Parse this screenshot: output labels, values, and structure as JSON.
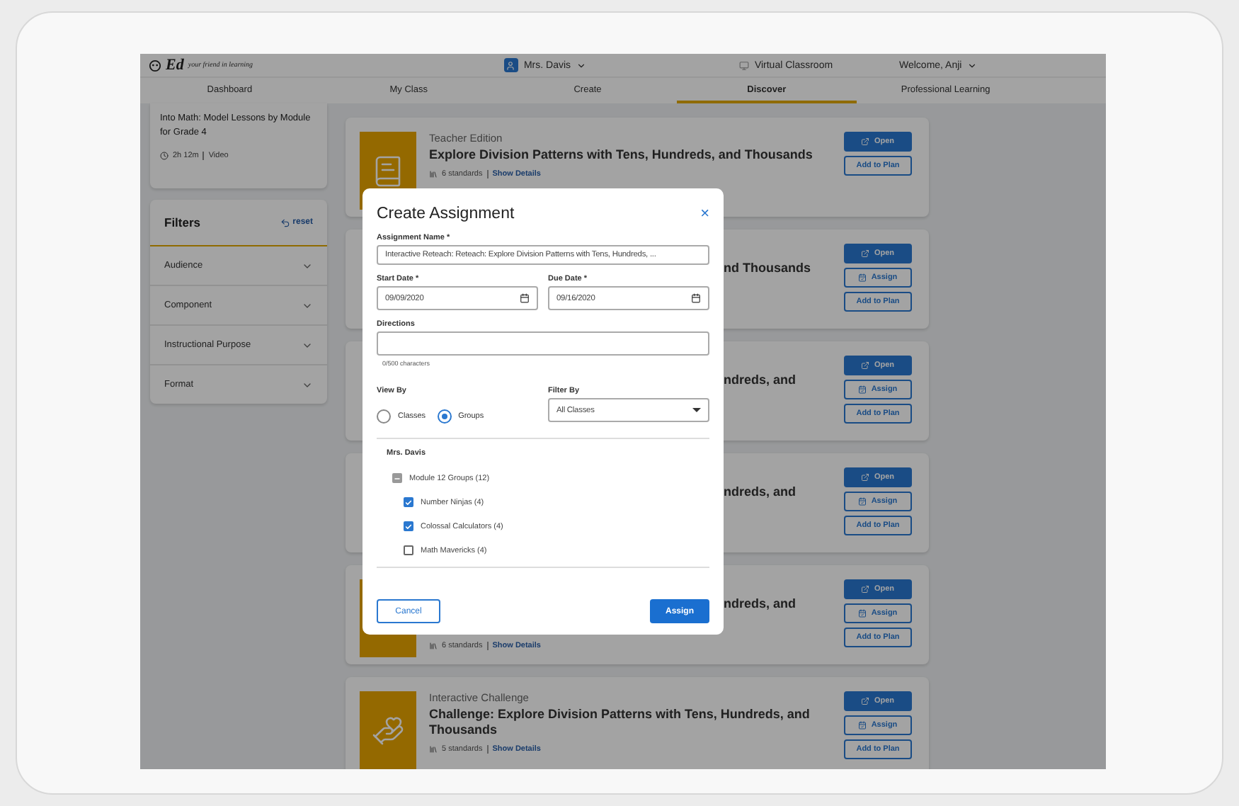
{
  "header": {
    "logo": {
      "text": "Ed",
      "tagline": "your friend in learning"
    },
    "teacher": "Mrs. Davis",
    "virtual": "Virtual Classroom",
    "welcome": "Welcome, Anji"
  },
  "nav": [
    {
      "label": "Dashboard",
      "selected": false
    },
    {
      "label": "My Class",
      "selected": false
    },
    {
      "label": "Create",
      "selected": false
    },
    {
      "label": "Discover",
      "selected": true
    },
    {
      "label": "Professional Learning",
      "selected": false
    }
  ],
  "sidebar": {
    "lesson": {
      "title": "Into Math: Model Lessons by Module for Grade 4",
      "duration": "2h 12m",
      "format": "Video"
    },
    "filters": {
      "title": "Filters",
      "reset": "reset",
      "items": [
        "Audience",
        "Component",
        "Instructional Purpose",
        "Format"
      ]
    }
  },
  "cards": [
    {
      "covered": false,
      "kind": "book",
      "type": "Teacher Edition",
      "title": "Explore Division Patterns with Tens, Hundreds, and Thousands",
      "standards": "6 standards",
      "details": "Show Details",
      "buttons": [
        {
          "kind": "open",
          "label": "Open"
        },
        {
          "kind": "plan",
          "label": "Add to Plan"
        }
      ]
    },
    {
      "covered": true,
      "title": "nd Thousands",
      "buttons": [
        {
          "kind": "open",
          "label": "Open"
        },
        {
          "kind": "assign",
          "label": "Assign"
        },
        {
          "kind": "plan",
          "label": "Add to Plan"
        }
      ]
    },
    {
      "covered": true,
      "title": "ndreds, and",
      "buttons": [
        {
          "kind": "open",
          "label": "Open"
        },
        {
          "kind": "assign",
          "label": "Assign"
        },
        {
          "kind": "plan",
          "label": "Add to Plan"
        }
      ]
    },
    {
      "covered": true,
      "title": "ndreds, and",
      "buttons": [
        {
          "kind": "open",
          "label": "Open"
        },
        {
          "kind": "assign",
          "label": "Assign"
        },
        {
          "kind": "plan",
          "label": "Add to Plan"
        }
      ]
    },
    {
      "covered": true,
      "kind": "blank",
      "title": "ndreds, and",
      "standards": "6 standards",
      "details": "Show Details",
      "buttons": [
        {
          "kind": "open",
          "label": "Open"
        },
        {
          "kind": "assign",
          "label": "Assign"
        },
        {
          "kind": "plan",
          "label": "Add to Plan"
        }
      ]
    },
    {
      "covered": false,
      "kind": "hand-book",
      "type": "Interactive Challenge",
      "title": "Challenge: Explore Division Patterns with Tens, Hundreds, and Thousands",
      "standards": "5 standards",
      "details": "Show Details",
      "buttons": [
        {
          "kind": "open",
          "label": "Open"
        },
        {
          "kind": "assign",
          "label": "Assign"
        },
        {
          "kind": "plan",
          "label": "Add to Plan"
        }
      ]
    }
  ],
  "modal": {
    "title": "Create Assignment",
    "close": "×",
    "name": {
      "label": "Assignment Name *",
      "value": "Interactive Reteach: Reteach: Explore Division Patterns with Tens, Hundreds, ..."
    },
    "start": {
      "label": "Start Date *",
      "value": "09/09/2020"
    },
    "due": {
      "label": "Due Date *",
      "value": "09/16/2020"
    },
    "directions": {
      "label": "Directions",
      "counter": "0/500 characters"
    },
    "view_by": {
      "label": "View By",
      "options": [
        {
          "label": "Classes",
          "selected": false
        },
        {
          "label": "Groups",
          "selected": true
        }
      ]
    },
    "filter_by": {
      "label": "Filter By",
      "value": "All Classes"
    },
    "owner": "Mrs. Davis",
    "tree": [
      {
        "label": "Module 12 Groups (12)",
        "indeterminate": true,
        "children": [
          {
            "label": "Number Ninjas (4)",
            "checked": true
          },
          {
            "label": "Colossal Calculators (4)",
            "checked": true
          },
          {
            "label": "Math Mavericks (4)",
            "checked": false
          }
        ]
      }
    ],
    "cancel": "Cancel",
    "assign": "Assign"
  }
}
